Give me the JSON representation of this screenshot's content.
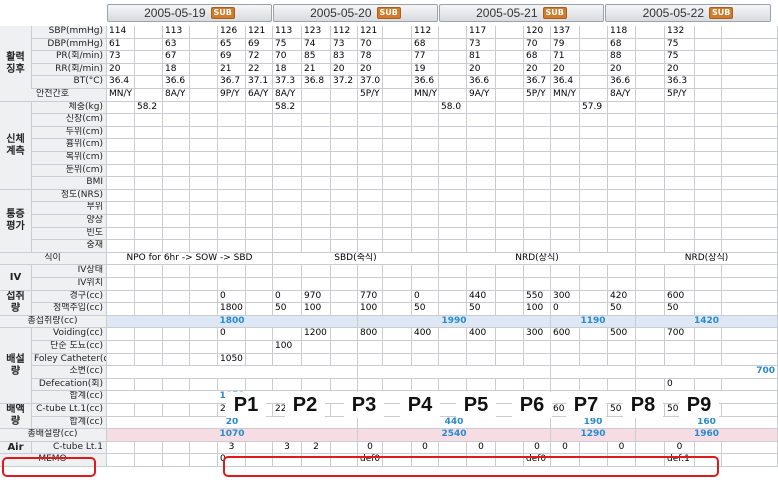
{
  "header": {
    "dates": [
      {
        "label": "2005-05-19",
        "sub": "SUB"
      },
      {
        "label": "2005-05-20",
        "sub": "SUB"
      },
      {
        "label": "2005-05-21",
        "sub": "SUB"
      },
      {
        "label": "2005-05-22",
        "sub": "SUB"
      }
    ]
  },
  "categories": {
    "vital": "활력 징후",
    "body": "신체 계측",
    "pain": "통증 평가",
    "iv": "IV",
    "intake": "섭취 량",
    "output": "배설 량",
    "drain": "배액 량",
    "air": "Air"
  },
  "rows": [
    {
      "label": "SBP(mmHg)",
      "cells": [
        "114",
        "",
        "113",
        "",
        "126",
        "121",
        "113",
        "123",
        "112",
        "121",
        "",
        "112",
        "",
        "117",
        "",
        "120",
        "137",
        "",
        "118",
        "",
        "132"
      ]
    },
    {
      "label": "DBP(mmHg)",
      "cells": [
        "61",
        "",
        "63",
        "",
        "65",
        "69",
        "75",
        "74",
        "73",
        "70",
        "",
        "68",
        "",
        "73",
        "",
        "70",
        "79",
        "",
        "68",
        "",
        "75"
      ]
    },
    {
      "label": "PR(회/min)",
      "cells": [
        "73",
        "",
        "67",
        "",
        "69",
        "72",
        "70",
        "85",
        "83",
        "78",
        "",
        "77",
        "",
        "81",
        "",
        "68",
        "71",
        "",
        "88",
        "",
        "75"
      ]
    },
    {
      "label": "RR(회/min)",
      "cells": [
        "20",
        "",
        "18",
        "",
        "21",
        "22",
        "18",
        "21",
        "20",
        "20",
        "",
        "19",
        "",
        "20",
        "",
        "20",
        "20",
        "",
        "20",
        "",
        "20"
      ]
    },
    {
      "label": "BT(°C)",
      "cells": [
        "36.4",
        "",
        "36.6",
        "",
        "36.7",
        "37.1",
        "37.3",
        "36.8",
        "37.2",
        "37.0",
        "",
        "36.6",
        "",
        "36.6",
        "",
        "36.7",
        "36.4",
        "",
        "36.6",
        "",
        "36.3"
      ]
    },
    {
      "label": "안전간호",
      "cells": [
        "MN/Y",
        "",
        "8A/Y",
        "",
        "9P/Y",
        "6A/Y",
        "8A/Y",
        "",
        "",
        "5P/Y",
        "",
        "MN/Y",
        "",
        "9A/Y",
        "",
        "5P/Y",
        "MN/Y",
        "",
        "8A/Y",
        "",
        "5P/Y"
      ]
    },
    {
      "label": "체중(kg)",
      "cells": [
        "",
        "58.2",
        "",
        "",
        "",
        "",
        "58.2",
        "",
        "",
        "",
        "",
        "",
        "58.0",
        "",
        "",
        "",
        "",
        "57.9",
        "",
        "",
        ""
      ]
    },
    {
      "label": "신장(cm)",
      "cells": []
    },
    {
      "label": "두위(cm)",
      "cells": []
    },
    {
      "label": "흉위(cm)",
      "cells": []
    },
    {
      "label": "복위(cm)",
      "cells": []
    },
    {
      "label": "둔위(cm)",
      "cells": []
    },
    {
      "label": "BMI",
      "cells": []
    },
    {
      "label": "정도(NRS)",
      "cells": []
    },
    {
      "label": "부위",
      "cells": []
    },
    {
      "label": "양상",
      "cells": []
    },
    {
      "label": "빈도",
      "cells": []
    },
    {
      "label": "중재",
      "cells": []
    },
    {
      "label": "식이",
      "cells": []
    },
    {
      "label": "IV상태",
      "cells": []
    },
    {
      "label": "IV위치",
      "cells": []
    },
    {
      "label": "경구(cc)",
      "cells": [
        "",
        "",
        "",
        "",
        "0",
        "",
        "0",
        "970",
        "",
        "770",
        "",
        "0",
        "",
        "440",
        "",
        "550",
        "300",
        "",
        "420",
        "",
        "600"
      ]
    },
    {
      "label": "정맥주입(cc)",
      "cells": [
        "",
        "",
        "",
        "",
        "1800",
        "",
        "50",
        "100",
        "",
        "100",
        "",
        "50",
        "",
        "50",
        "",
        "100",
        "0",
        "",
        "50",
        "",
        "50"
      ]
    },
    {
      "label": "총섭취량(cc)",
      "cells": []
    },
    {
      "label": "Voiding(cc)",
      "cells": [
        "",
        "",
        "",
        "",
        "0",
        "",
        "",
        "1200",
        "",
        "800",
        "",
        "400",
        "",
        "400",
        "",
        "300",
        "600",
        "",
        "500",
        "",
        "700"
      ]
    },
    {
      "label": "단순 도뇨(cc)",
      "cells": [
        "",
        "",
        "",
        "",
        "",
        "",
        "100",
        "",
        "",
        "",
        "",
        "",
        "",
        "",
        "",
        "",
        "",
        "",
        "",
        "",
        ""
      ]
    },
    {
      "label": "Foley Catheter(cc)",
      "cells": [
        "",
        "",
        "",
        "",
        "1050",
        "",
        "",
        "",
        "",
        "",
        "",
        "",
        "",
        "",
        "",
        "",
        "",
        "",
        "",
        "",
        ""
      ]
    },
    {
      "label": "소변(cc)",
      "cells": []
    },
    {
      "label": "Defecation(회)",
      "cells": [
        "",
        "",
        "",
        "",
        "",
        "",
        "",
        "",
        "",
        "",
        "",
        "",
        "",
        "",
        "",
        "",
        "",
        "",
        "",
        "",
        "0"
      ]
    },
    {
      "label": "합계(cc)",
      "cells": []
    },
    {
      "label": "C-tube Lt.1(cc)",
      "cells": [
        "",
        "",
        "",
        "",
        "20",
        "",
        "220",
        "140",
        "",
        "80",
        "",
        "80",
        "",
        "70",
        "",
        "40",
        "60",
        "",
        "50",
        "",
        "50"
      ]
    },
    {
      "label": "합계(cc)",
      "cells": []
    },
    {
      "label": "총배설량(cc)",
      "cells": []
    },
    {
      "label": "C-tube Lt.1",
      "cells": [
        "",
        "",
        "",
        "",
        "3",
        "",
        "3",
        "2",
        "",
        "0",
        "",
        "0",
        "",
        "0",
        "",
        "0",
        "0",
        "",
        "0",
        "",
        "0"
      ]
    },
    {
      "label": "MEMO",
      "cells": [
        "",
        "",
        "",
        "",
        "0",
        "",
        "",
        "",
        "",
        "def0",
        "",
        "",
        "",
        "",
        "",
        "def0",
        "",
        "",
        "",
        "",
        "def:1"
      ]
    }
  ],
  "spans": {
    "diet": [
      "NPO for 6hr -> SOW -> SBD",
      "SBD(죽식)",
      "NRD(상식)",
      "NRD(상식)"
    ],
    "total_intake": [
      "1800",
      "1990",
      "1190",
      "1420"
    ],
    "urine": [
      "",
      "",
      "",
      "700"
    ],
    "output_sum": [
      "1050",
      "",
      "",
      ""
    ],
    "drain_sum": [
      "20",
      "440",
      "190",
      "160"
    ],
    "total_output": [
      "1070",
      "2540",
      "1290",
      "1960"
    ]
  },
  "p_labels": [
    "P1",
    "P2",
    "P3",
    "P4",
    "P5",
    "P6",
    "P7",
    "P8",
    "P9"
  ]
}
